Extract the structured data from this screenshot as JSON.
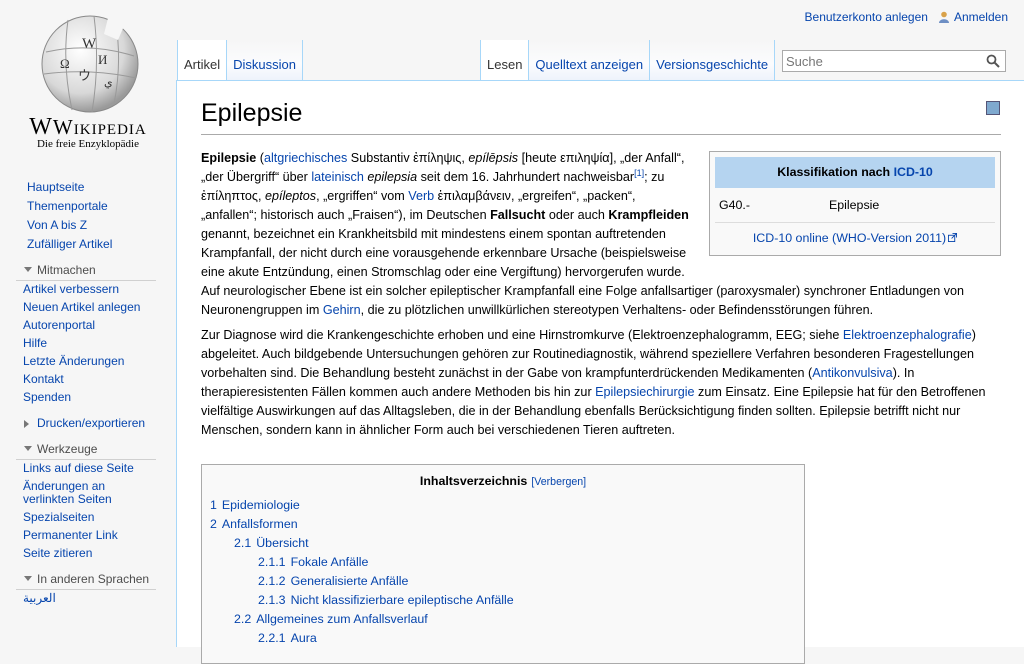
{
  "personal": {
    "create_account": "Benutzerkonto anlegen",
    "login": "Anmelden"
  },
  "logo": {
    "wordmark": "Wikipedia",
    "tagline": "Die freie Enzyklopädie"
  },
  "sidebar": {
    "nav": [
      "Hauptseite",
      "Themenportale",
      "Von A bis Z",
      "Zufälliger Artikel"
    ],
    "mitmachen": {
      "title": "Mitmachen",
      "items": [
        "Artikel verbessern",
        "Neuen Artikel anlegen",
        "Autorenportal",
        "Hilfe",
        "Letzte Änderungen",
        "Kontakt",
        "Spenden"
      ]
    },
    "drucken": {
      "title": "Drucken/exportieren"
    },
    "werkzeuge": {
      "title": "Werkzeuge",
      "items": [
        "Links auf diese Seite",
        "Änderungen an verlinkten Seiten",
        "Spezialseiten",
        "Permanenter Link",
        "Seite zitieren"
      ]
    },
    "sprachen": {
      "title": "In anderen Sprachen",
      "items": [
        "العربية"
      ]
    }
  },
  "tabs": {
    "article": "Artikel",
    "discussion": "Diskussion",
    "read": "Lesen",
    "source": "Quelltext anzeigen",
    "history": "Versionsgeschichte"
  },
  "search": {
    "placeholder": "Suche"
  },
  "page": {
    "title": "Epilepsie"
  },
  "infobox": {
    "head_prefix": "Klassifikation nach ",
    "head_link": "ICD-10",
    "code": "G40.-",
    "name": "Epilepsie",
    "footer_link": "ICD-10 online (WHO-Version 2011)"
  },
  "para1": {
    "t0": "Epilepsie",
    "t1": " (",
    "l1": "altgriechisches",
    "t2": " Substantiv ἐπίληψις, ",
    "i1": "epílēpsis",
    "t3": " [heute επιληψία], „der Anfall“, „der Übergriff“ über ",
    "l2": "lateinisch",
    "t4": " ",
    "i2": "epilepsia",
    "t5": " seit dem 16. Jahrhundert nachweisbar",
    "ref": "[1]",
    "t6": "; zu ἐπίληπτος, ",
    "i3": "epíleptos",
    "t7": ", „ergriffen“ vom ",
    "l3": "Verb",
    "t8": " ἐπιλαμβάνειν, „ergreifen“, „packen“, „anfallen“; historisch auch „Fraisen“), im Deutschen ",
    "b1": "Fallsucht",
    "t9": " oder auch ",
    "b2": "Krampfleiden",
    "t10": " genannt, bezeichnet ein Krankheitsbild mit mindestens einem spontan auftretenden Krampfanfall, der nicht durch eine vorausgehende erkennbare Ursache (beispielsweise eine akute Entzündung, einen Stromschlag oder eine Vergiftung) hervorgerufen wurde. Auf neurologischer Ebene ist ein solcher epileptischer Krampfanfall eine Folge anfallsartiger (paroxysmaler) synchroner Entladungen von Neuronengruppen im ",
    "l4": "Gehirn",
    "t11": ", die zu plötzlichen unwillkürlichen stereotypen Verhaltens- oder Befindensstörungen führen."
  },
  "para2": {
    "t0": "Zur Diagnose wird die Krankengeschichte erhoben und eine Hirnstromkurve (Elektroenzephalogramm, EEG; siehe ",
    "l1": "Elektroenzephalografie",
    "t1": ") abgeleitet. Auch bildgebende Untersuchungen gehören zur Routinediagnostik, während speziellere Verfahren besonderen Fragestellungen vorbehalten sind. Die Behandlung besteht zunächst in der Gabe von krampfunterdrückenden Medikamenten (",
    "l2": "Antikonvulsiva",
    "t2": "). In therapieresistenten Fällen kommen auch andere Methoden bis hin zur ",
    "l3": "Epilepsiechirurgie",
    "t3": " zum Einsatz. Eine Epilepsie hat für den Betroffenen vielfältige Auswirkungen auf das Alltagsleben, die in der Behandlung ebenfalls Berücksichtigung finden sollten. Epilepsie betrifft nicht nur Menschen, sondern kann in ähnlicher Form auch bei verschiedenen Tieren auftreten."
  },
  "toc": {
    "title": "Inhaltsverzeichnis",
    "toggle": "[Verbergen]",
    "items": [
      {
        "num": "1",
        "label": "Epidemiologie"
      },
      {
        "num": "2",
        "label": "Anfallsformen"
      },
      {
        "num": "2.1",
        "label": "Übersicht"
      },
      {
        "num": "2.1.1",
        "label": "Fokale Anfälle"
      },
      {
        "num": "2.1.2",
        "label": "Generalisierte Anfälle"
      },
      {
        "num": "2.1.3",
        "label": "Nicht klassifizierbare epileptische Anfälle"
      },
      {
        "num": "2.2",
        "label": "Allgemeines zum Anfallsverlauf"
      },
      {
        "num": "2.2.1",
        "label": "Aura"
      }
    ]
  },
  "colors": {
    "link": "#0645ad",
    "tab_border": "#a7d7f9",
    "infobox_head": "#b5d4f0"
  }
}
